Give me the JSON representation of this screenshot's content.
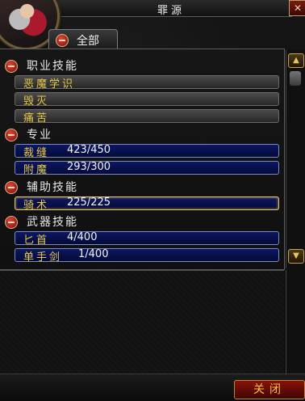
{
  "window": {
    "title": "罪源",
    "close_glyph": "✕"
  },
  "tab": {
    "label": "全部"
  },
  "categories": [
    {
      "label": "职业技能",
      "skills": [
        {
          "name": "恶魔学识",
          "rank": ""
        },
        {
          "name": "毁灭",
          "rank": ""
        },
        {
          "name": "痛苦",
          "rank": ""
        }
      ]
    },
    {
      "label": "专业",
      "skills": [
        {
          "name": "裁缝",
          "rank": "423/450"
        },
        {
          "name": "附魔",
          "rank": "293/300"
        }
      ]
    },
    {
      "label": "辅助技能",
      "skills": [
        {
          "name": "骑术",
          "rank": "225/225"
        }
      ]
    },
    {
      "label": "武器技能",
      "skills": [
        {
          "name": "匕首",
          "rank": "4/400"
        },
        {
          "name": "单手剑",
          "rank": "1/400"
        }
      ]
    }
  ],
  "footer": {
    "close_label": "关闭"
  },
  "icons": {
    "collapse": "minus-circle-icon",
    "scroll_up": "▲",
    "scroll_down": "▼"
  },
  "colors": {
    "accent_gold": "#e7c94b",
    "bar_blue": "#0c1760",
    "bar_gray": "#3a3a3a",
    "collapse_red": "#c0261a"
  }
}
